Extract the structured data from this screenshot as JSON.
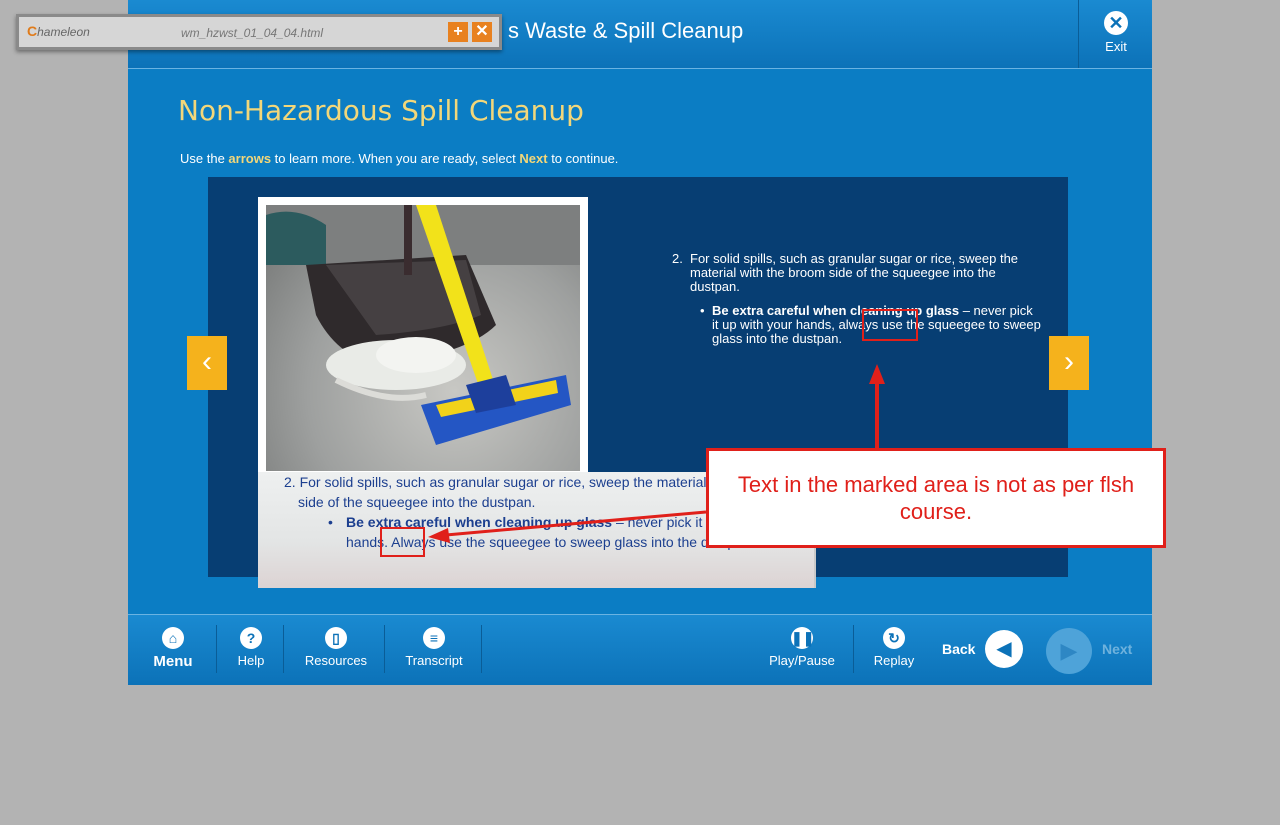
{
  "app": {
    "course_title": "s Waste & Spill Cleanup",
    "exit_label": "Exit"
  },
  "page": {
    "title": "Non-Hazardous Spill Cleanup",
    "instruction_pre": "Use the ",
    "instruction_arrows": "arrows",
    "instruction_mid": " to learn more.  When you are ready, select ",
    "instruction_next": "Next",
    "instruction_post": " to continue."
  },
  "content": {
    "step_number": "2.",
    "step_text": "For solid spills, such as granular sugar or rice, sweep the material with the broom side of the squeegee into the dustpan.",
    "bullet_bold": "Be extra careful when cleaning up glass",
    "bullet_text": " – never pick it up with your hands, always use the squeegee to sweep glass into the dustpan.",
    "prev_glyph": "‹",
    "next_glyph": "›"
  },
  "comparison": {
    "step_text": "2. For solid spills, such as granular sugar or rice, sweep the material with the broom side of the squeegee into the dustpan.",
    "bullet_bold": "Be extra careful when cleaning up glass",
    "bullet_text": " – never pick it up with your hands.  Always use the squeegee to sweep glass into the dustpan."
  },
  "annotation": {
    "callout_text": "Text in the marked area is not as per flsh course."
  },
  "navbar": {
    "menu": "Menu",
    "help": "Help",
    "resources": "Resources",
    "transcript": "Transcript",
    "playpause": "Play/Pause",
    "replay": "Replay",
    "back": "Back",
    "next": "Next"
  },
  "toolbar": {
    "logo_initial": "C",
    "logo_text": "hameleon",
    "filename": "wm_hzwst_01_04_04.html",
    "plus_glyph": "+",
    "close_glyph": "✕"
  },
  "icons": {
    "home": "home-icon",
    "help": "question-icon",
    "resources": "document-icon",
    "transcript": "lines-icon",
    "playpause": "pause-icon",
    "replay": "replay-icon"
  },
  "colors": {
    "primary_blue": "#0b7dc4",
    "panel_navy": "#073e73",
    "accent_yellow": "#f5b21c",
    "title_gold": "#f2d77a",
    "annotation_red": "#e0201a"
  }
}
